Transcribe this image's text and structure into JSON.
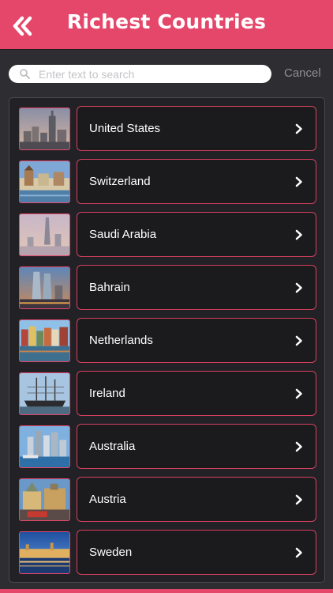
{
  "header": {
    "title": "Richest Countries",
    "back_icon": "double-chevron-left-icon",
    "background": "#e5476b"
  },
  "search": {
    "placeholder": "Enter text to search",
    "value": "",
    "cancel_label": "Cancel"
  },
  "countries": [
    {
      "name": "United States"
    },
    {
      "name": "Switzerland"
    },
    {
      "name": "Saudi Arabia"
    },
    {
      "name": "Bahrain"
    },
    {
      "name": "Netherlands"
    },
    {
      "name": "Ireland"
    },
    {
      "name": "Australia"
    },
    {
      "name": "Austria"
    },
    {
      "name": "Sweden"
    }
  ],
  "colors": {
    "accent": "#e5476b",
    "background": "#2e2e32",
    "row_background": "#1b1b1e"
  }
}
